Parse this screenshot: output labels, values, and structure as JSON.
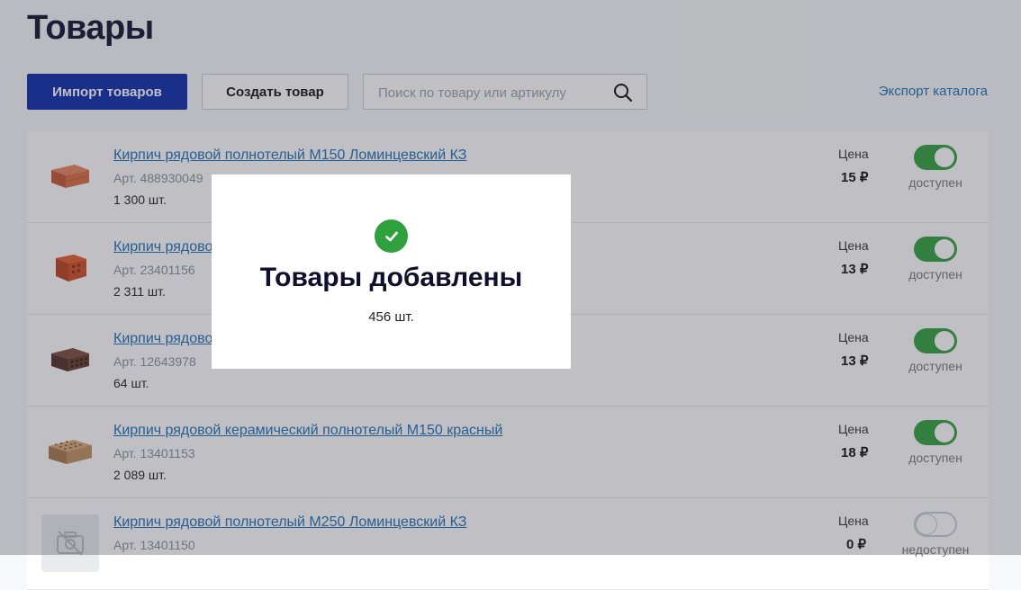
{
  "page": {
    "title": "Товары"
  },
  "toolbar": {
    "import_label": "Импорт товаров",
    "create_label": "Создать товар",
    "search_placeholder": "Поиск по товару или артикулу",
    "export_label": "Экспорт каталога"
  },
  "colors": {
    "accent": "#0a2aa8",
    "link": "#1b6fb5",
    "success": "#2ea03c"
  },
  "products": [
    {
      "name": "Кирпич рядовой полнотелый М150 Ломинцевский КЗ",
      "sku": "Арт. 488930049",
      "qty": "1 300 шт.",
      "price_label": "Цена",
      "price": "15 ₽",
      "status": "доступен",
      "available": true,
      "image": "brick-red-solid"
    },
    {
      "name": "Кирпич рядовой",
      "sku": "Арт. 23401156",
      "qty": "2 311 шт.",
      "price_label": "Цена",
      "price": "13 ₽",
      "status": "доступен",
      "available": true,
      "image": "brick-red-hollow"
    },
    {
      "name": "Кирпич рядовой",
      "sku": "Арт. 12643978",
      "qty": "64 шт.",
      "price_label": "Цена",
      "price": "13 ₽",
      "status": "доступен",
      "available": true,
      "image": "brick-dark-hollow"
    },
    {
      "name": "Кирпич рядовой керамический полнотелый М150 красный",
      "sku": "Арт. 13401153",
      "qty": "2 089 шт.",
      "price_label": "Цена",
      "price": "18 ₽",
      "status": "доступен",
      "available": true,
      "image": "brick-tan-holes"
    },
    {
      "name": "Кирпич рядовой полнотелый М250 Ломинцевский КЗ",
      "sku": "Арт. 13401150",
      "qty": "",
      "price_label": "Цена",
      "price": "0 ₽",
      "status": "недоступен",
      "available": false,
      "image": "no-photo-icon"
    }
  ],
  "modal": {
    "title": "Товары добавлены",
    "subtitle": "456 шт.",
    "icon": "check-circle-icon"
  }
}
